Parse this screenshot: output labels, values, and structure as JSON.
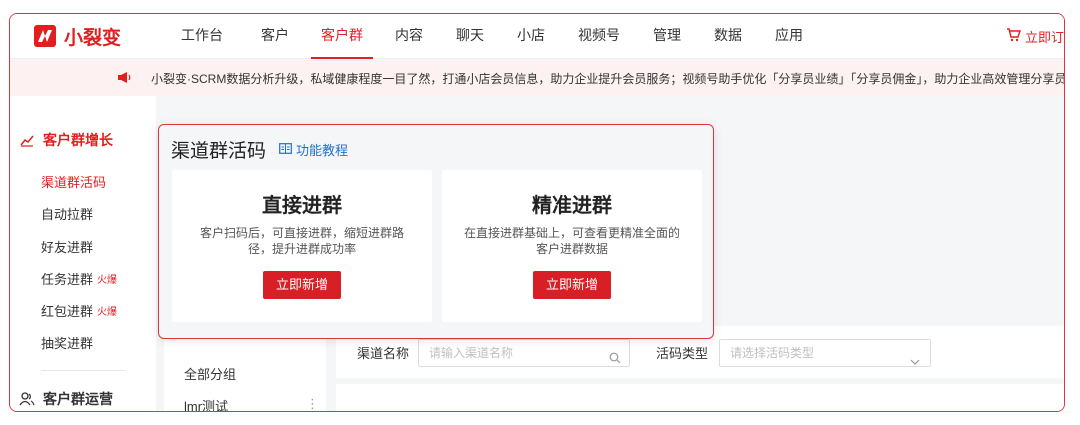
{
  "brand": {
    "name": "小裂变",
    "color": "#e02020"
  },
  "nav": {
    "items": [
      {
        "label": "工作台",
        "active": false
      },
      {
        "label": "客户",
        "active": false
      },
      {
        "label": "客户群",
        "active": true
      },
      {
        "label": "内容",
        "active": false
      },
      {
        "label": "聊天",
        "active": false
      },
      {
        "label": "小店",
        "active": false
      },
      {
        "label": "视频号",
        "active": false
      },
      {
        "label": "管理",
        "active": false
      },
      {
        "label": "数据",
        "active": false
      },
      {
        "label": "应用",
        "active": false
      }
    ],
    "order_label": "立即订",
    "order_icon": "cart-icon"
  },
  "notice": {
    "icon": "megaphone-icon",
    "text": "小裂变·SCRM数据分析升级，私域健康程度一目了然，打通小店会员信息，助力企业提升会员服务；视频号助手优化「分享员业绩」「分享员佣金」，助力企业高效管理分享员"
  },
  "sidebar": {
    "group1": {
      "label": "客户群增长",
      "icon": "growth-chart-icon"
    },
    "items": [
      {
        "label": "渠道群活码",
        "active": true,
        "hot": ""
      },
      {
        "label": "自动拉群",
        "active": false,
        "hot": ""
      },
      {
        "label": "好友进群",
        "active": false,
        "hot": ""
      },
      {
        "label": "任务进群",
        "active": false,
        "hot": "火爆"
      },
      {
        "label": "红包进群",
        "active": false,
        "hot": "火爆"
      },
      {
        "label": "抽奖进群",
        "active": false,
        "hot": ""
      }
    ],
    "group2": {
      "label": "客户群运营",
      "icon": "users-icon"
    }
  },
  "grouplist": {
    "items": [
      {
        "label": "全部分组"
      },
      {
        "label": "lmr测试"
      }
    ],
    "more_icon": "more-vertical-icon"
  },
  "filter": {
    "channel_label": "渠道名称",
    "channel_placeholder": "请输入渠道名称",
    "type_label": "活码类型",
    "type_placeholder": "请选择活码类型"
  },
  "overlay": {
    "title": "渠道群活码",
    "tutorial_label": "功能教程",
    "cards": [
      {
        "title": "直接进群",
        "desc": "客户扫码后，可直接进群，缩短进群路径，提升进群成功率",
        "button": "立即新增"
      },
      {
        "title": "精准进群",
        "desc": "在直接进群基础上，可查看更精准全面的客户进群数据",
        "button": "立即新增"
      }
    ]
  },
  "colors": {
    "accent": "#e02020",
    "highlight_border": "#d9363e",
    "link": "#1f6fd6"
  }
}
